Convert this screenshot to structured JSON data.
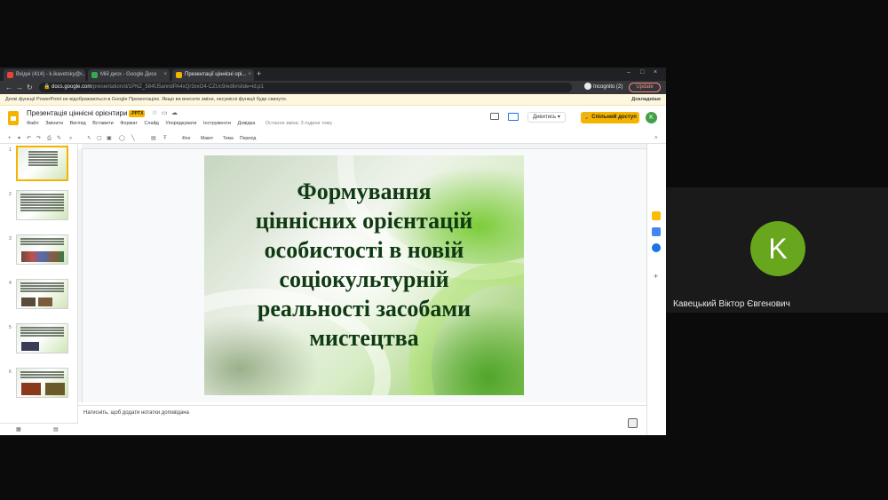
{
  "browser": {
    "tabs": [
      {
        "label": "Вхідні (414) - k.ikavetsky@...",
        "favicon_color": "#ea4335"
      },
      {
        "label": "Мій диск - Google Диск",
        "favicon_color": "#34a853"
      },
      {
        "label": "Презентації ціннісні орі...",
        "favicon_color": "#f4b400"
      }
    ],
    "new_tab_label": "+",
    "url_host": "docs.google.com",
    "url_path": "/presentation/d/1PNZ_584fJ5anndPA4xQr3xxO4-CZUc9/edit#slide=id.p1",
    "incognito_label": "Incognito (2)",
    "update_label": "Update",
    "window_controls": [
      "–",
      "□",
      "×"
    ]
  },
  "infobar": {
    "message": "Деякі функції PowerPoint не відображаються в Google Презентаціях. Якщо ви внесете зміни, несумісні функції буде скинуто.",
    "details_label": "Докладніше"
  },
  "doc": {
    "title": "Презентація ціннісні орієнтири 21",
    "badge": ".PPTX",
    "menus": [
      "Файл",
      "Змінити",
      "Вигляд",
      "Вставити",
      "Формат",
      "Слайд",
      "Упорядкувати",
      "Інструменти",
      "Довідка"
    ],
    "last_edit": "Остання зміна: 3 години тому",
    "watch_label": "Дивитись",
    "share_label": "Спільний доступ",
    "user_initial": "K"
  },
  "toolbar": {
    "background_label": "Фон",
    "layout_label": "Макет",
    "theme_label": "Тема",
    "transition_label": "Перехід"
  },
  "thumbnails": [
    "1",
    "2",
    "3",
    "4",
    "5",
    "6"
  ],
  "slide": {
    "title": "Формування\nціннісних орієнтацій\nособистості в новій\nсоціокультурній\nреальності засобами\nмистецтва",
    "title_color": "#0f3a12"
  },
  "notes": {
    "placeholder": "Натисніть, щоб додати нотатки доповідача"
  },
  "participant": {
    "initial": "K",
    "name": "Кавецький Віктор Євгенович",
    "avatar_color": "#68a61d"
  }
}
